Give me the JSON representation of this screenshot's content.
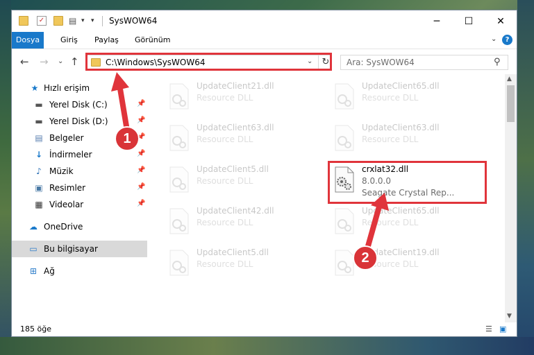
{
  "window": {
    "title": "SysWOW64",
    "minimize": "─",
    "maximize": "☐",
    "close": "✕"
  },
  "ribbon": {
    "tabs": [
      "Dosya",
      "Giriş",
      "Paylaş",
      "Görünüm"
    ],
    "help": "?",
    "collapse": "⌄"
  },
  "nav": {
    "back": "←",
    "forward": "→",
    "recent": "⌄",
    "up": "↑",
    "address": "C:\\Windows\\SysWOW64",
    "search_placeholder": "Ara: SysWOW64"
  },
  "sidebar": {
    "items": [
      {
        "label": "Hızlı erişim",
        "icon": "star-icon"
      },
      {
        "label": "Yerel Disk (C:)",
        "icon": "drive-icon",
        "pinned": true
      },
      {
        "label": "Yerel Disk (D:)",
        "icon": "drive-icon",
        "pinned": true
      },
      {
        "label": "Belgeler",
        "icon": "documents-icon",
        "pinned": true
      },
      {
        "label": "İndirmeler",
        "icon": "downloads-icon",
        "pinned": true
      },
      {
        "label": "Müzik",
        "icon": "music-icon",
        "pinned": true
      },
      {
        "label": "Resimler",
        "icon": "pictures-icon",
        "pinned": true
      },
      {
        "label": "Videolar",
        "icon": "videos-icon",
        "pinned": true
      },
      {
        "label": "OneDrive",
        "icon": "cloud-icon"
      },
      {
        "label": "Bu bilgisayar",
        "icon": "computer-icon",
        "selected": true
      },
      {
        "label": "Ağ",
        "icon": "network-icon"
      }
    ]
  },
  "files": [
    {
      "name": "UpdateClient21.dll",
      "desc": "Resource DLL",
      "faded": true
    },
    {
      "name": "UpdateClient65.dll",
      "desc": "Resource DLL",
      "faded": true
    },
    {
      "name": "UpdateClient63.dll",
      "desc": "Resource DLL",
      "faded": true
    },
    {
      "name": "UpdateClient63.dll",
      "desc": "Resource DLL",
      "faded": true
    },
    {
      "name": "UpdateClient5.dll",
      "desc": "Resource DLL",
      "faded": true
    },
    {
      "name": "crxlat32.dll",
      "version": "8.0.0.0",
      "desc": "Seagate Crystal Rep...",
      "faded": false
    },
    {
      "name": "UpdateClient42.dll",
      "desc": "Resource DLL",
      "faded": true
    },
    {
      "name": "UpdateClient65.dll",
      "desc": "Resource DLL",
      "faded": true
    },
    {
      "name": "UpdateClient5.dll",
      "desc": "Resource DLL",
      "faded": true
    },
    {
      "name": "UpdateClient19.dll",
      "desc": "Resource DLL",
      "faded": true
    }
  ],
  "status": {
    "count": "185 öğe"
  },
  "callouts": [
    "1",
    "2"
  ],
  "colors": {
    "accent": "#1979ca",
    "highlight": "#e0343b",
    "selected_bg": "#d9d9d9"
  }
}
